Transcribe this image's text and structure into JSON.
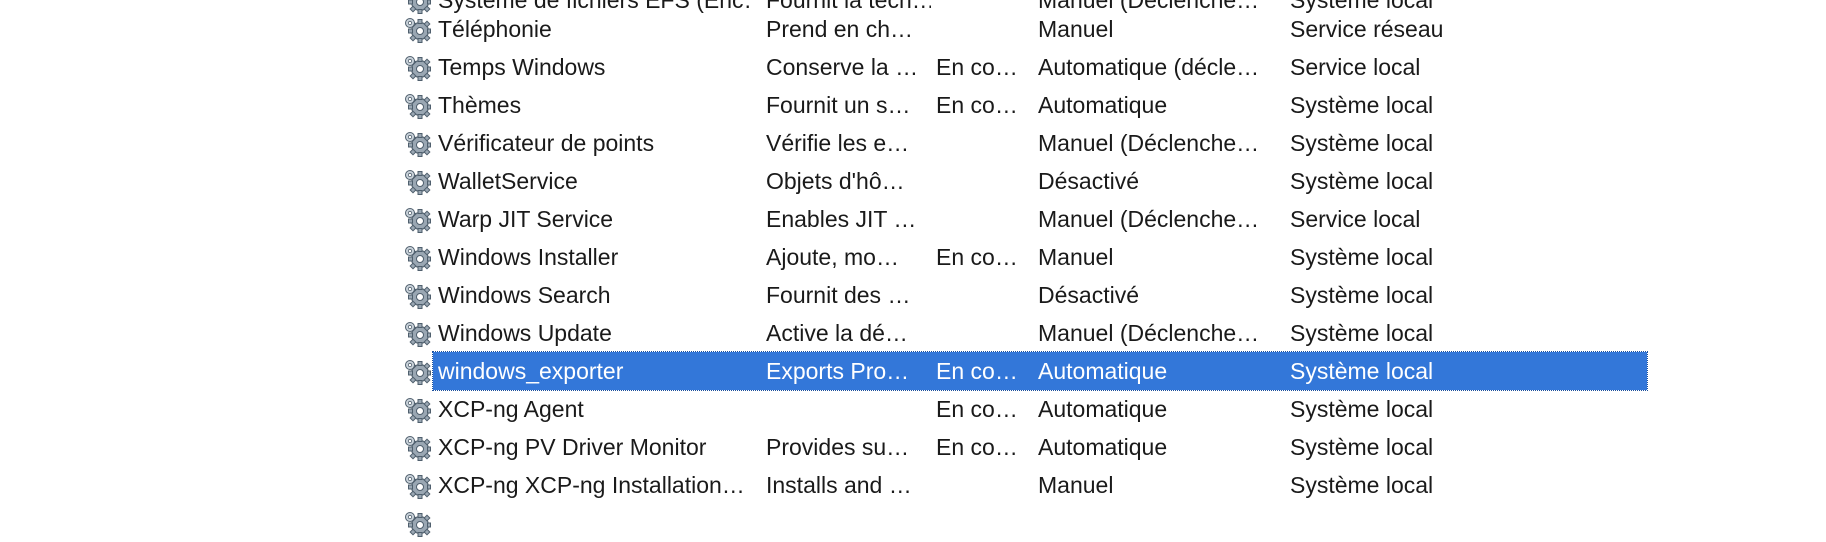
{
  "services": [
    {
      "name": "Système de fichiers EFS (Enc…",
      "description": "Fournit la tech…",
      "state": "",
      "startup": "Manuel (Déclenche…",
      "logon": "Système local"
    },
    {
      "name": "Téléphonie",
      "description": "Prend en ch…",
      "state": "",
      "startup": "Manuel",
      "logon": "Service réseau"
    },
    {
      "name": "Temps Windows",
      "description": "Conserve la …",
      "state": "En co…",
      "startup": "Automatique (décle…",
      "logon": "Service local"
    },
    {
      "name": "Thèmes",
      "description": "Fournit un s…",
      "state": "En co…",
      "startup": "Automatique",
      "logon": "Système local"
    },
    {
      "name": "Vérificateur de points",
      "description": "Vérifie les e…",
      "state": "",
      "startup": "Manuel (Déclenche…",
      "logon": "Système local"
    },
    {
      "name": "WalletService",
      "description": "Objets d'hô…",
      "state": "",
      "startup": "Désactivé",
      "logon": "Système local"
    },
    {
      "name": "Warp JIT Service",
      "description": "Enables JIT …",
      "state": "",
      "startup": "Manuel (Déclenche…",
      "logon": "Service local"
    },
    {
      "name": "Windows Installer",
      "description": "Ajoute, mo…",
      "state": "En co…",
      "startup": "Manuel",
      "logon": "Système local"
    },
    {
      "name": "Windows Search",
      "description": "Fournit des …",
      "state": "",
      "startup": "Désactivé",
      "logon": "Système local"
    },
    {
      "name": "Windows Update",
      "description": "Active la dé…",
      "state": "",
      "startup": "Manuel (Déclenche…",
      "logon": "Système local"
    },
    {
      "name": "windows_exporter",
      "description": "Exports Pro…",
      "state": "En co…",
      "startup": "Automatique",
      "logon": "Système local",
      "selected": true
    },
    {
      "name": "XCP-ng Agent",
      "description": "",
      "state": "En co…",
      "startup": "Automatique",
      "logon": "Système local"
    },
    {
      "name": "XCP-ng PV Driver Monitor",
      "description": "Provides su…",
      "state": "En co…",
      "startup": "Automatique",
      "logon": "Système local"
    },
    {
      "name": "XCP-ng XCP-ng Installation…",
      "description": "Installs and …",
      "state": "",
      "startup": "Manuel",
      "logon": "Système local"
    },
    {
      "name": "",
      "description": "",
      "state": "",
      "startup": "",
      "logon": ""
    }
  ],
  "colors": {
    "selection": "#3377d9",
    "text": "#1a1a1a",
    "selected_text": "#ffffff"
  },
  "row_icon": "gear-icon"
}
